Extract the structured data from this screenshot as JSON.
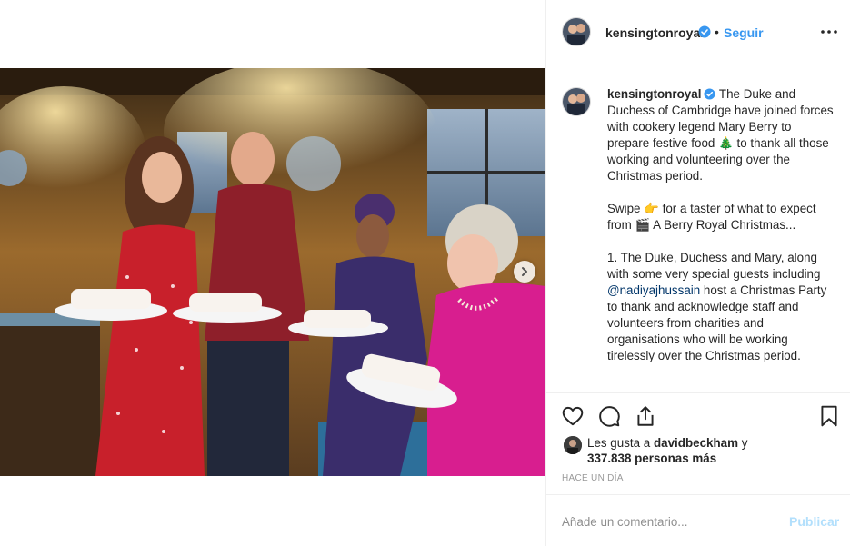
{
  "post": {
    "username": "kensingtonroyal",
    "follow_label": "Seguir",
    "dot_separator": "•",
    "caption": {
      "username": "kensingtonroyal",
      "p1_text": " The Duke and Duchess of Cambridge have joined forces with cookery legend Mary Berry to prepare festive food ",
      "p1_emoji": "🎄",
      "p1_end": " to thank all those working and volunteering over the Christmas period.",
      "p2_start": "Swipe ",
      "p2_emoji1": "👉",
      "p2_mid": " for a taster of what to expect from ",
      "p2_emoji2": "🎬",
      "p2_end": " A Berry Royal Christmas...",
      "p3_start": "1. The Duke, Duchess and Mary, along with some very special guests including ",
      "p3_mention": "@nadiyajhussain",
      "p3_end": " host a Christmas Party to thank and acknowledge staff and volunteers from charities and organisations who will be working tirelessly over the Christmas period."
    },
    "likes": {
      "prefix": "Les gusta a ",
      "liker": "davidbeckham",
      "suffix": " y",
      "count_text": "337.838 personas más"
    },
    "timestamp": "Hace un día",
    "comment": {
      "placeholder": "Añade un comentario...",
      "value": "",
      "publish_label": "Publicar"
    }
  },
  "icons": {
    "verified": "verified-badge-icon",
    "more": "more-options-icon",
    "like": "heart-icon",
    "comment": "comment-bubble-icon",
    "share": "share-icon",
    "save": "bookmark-icon",
    "next": "chevron-right-icon"
  },
  "colors": {
    "accent": "#3897f0",
    "publish_disabled": "#b2dffc",
    "mention": "#003569",
    "muted": "#8e8e8e"
  }
}
